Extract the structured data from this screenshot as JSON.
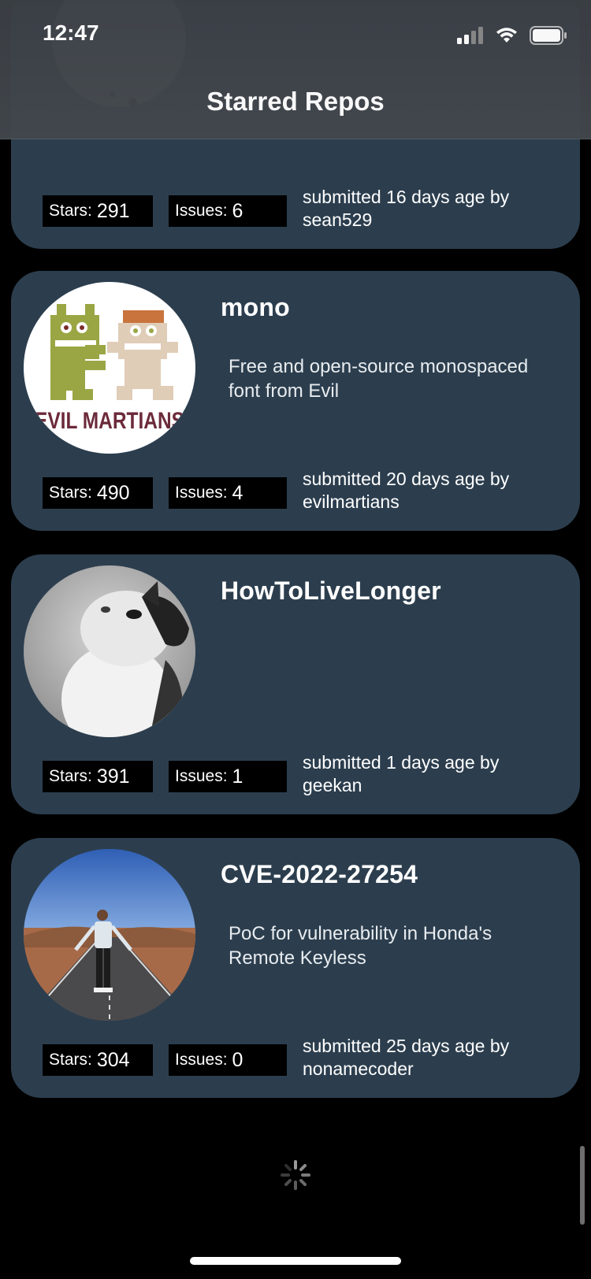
{
  "status_bar": {
    "time": "12:47",
    "icons": [
      "cellular-signal-icon",
      "wifi-icon",
      "battery-icon"
    ]
  },
  "nav": {
    "title": "Starred Repos"
  },
  "labels": {
    "stars_prefix": "Stars:",
    "issues_prefix": "Issues:"
  },
  "repos": [
    {
      "name": "",
      "description": "",
      "stars": "291",
      "issues": "6",
      "submitted": "submitted 16 days age by sean529"
    },
    {
      "name": "mono",
      "description": "Free and open-source monospaced font from Evil",
      "avatar_logo_text": "EVIL MARTIANS",
      "stars": "490",
      "issues": "4",
      "submitted": "submitted 20 days age by evilmartians"
    },
    {
      "name": "HowToLiveLonger",
      "description": "",
      "stars": "391",
      "issues": "1",
      "submitted": "submitted 1 days age by geekan"
    },
    {
      "name": "CVE-2022-27254",
      "description": "PoC for vulnerability in Honda's Remote Keyless",
      "stars": "304",
      "issues": "0",
      "submitted": "submitted 25 days age by nonamecoder"
    }
  ],
  "colors": {
    "card_background": "#2c3e4e",
    "page_background": "#000000",
    "header_background": "#43484d",
    "stat_background": "#000000"
  }
}
